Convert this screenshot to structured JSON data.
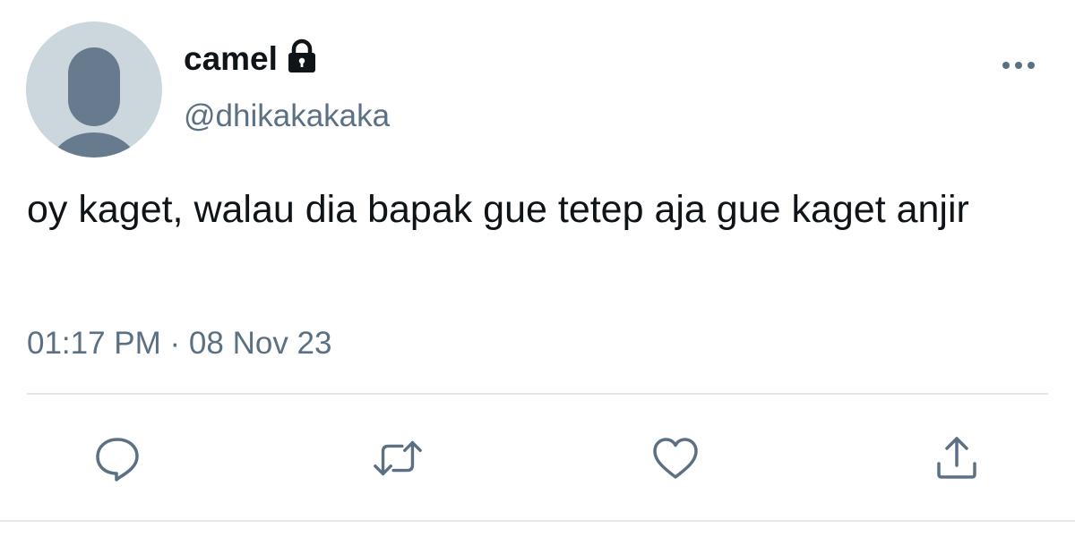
{
  "tweet": {
    "display_name": "camel",
    "handle": "@dhikakakaka",
    "text": "oy kaget, walau dia bapak gue tetep aja gue kaget anjir",
    "time": "01:17 PM",
    "separator": " · ",
    "date": "08 Nov 23",
    "protected_icon": "lock-icon",
    "avatar": "default-profile-silhouette"
  },
  "actions": [
    {
      "name": "reply",
      "icon": "comment-bubble-icon"
    },
    {
      "name": "retweet",
      "icon": "retweet-arrows-icon"
    },
    {
      "name": "like",
      "icon": "heart-icon"
    },
    {
      "name": "share",
      "icon": "share-upload-icon"
    }
  ],
  "menu_icon": "more-dots-icon",
  "colors": {
    "text_primary": "#0f1419",
    "text_secondary": "#5b7083",
    "avatar_bg": "#ccd6dd",
    "avatar_silhouette": "#687b8e",
    "divider": "#e1e8ed"
  }
}
